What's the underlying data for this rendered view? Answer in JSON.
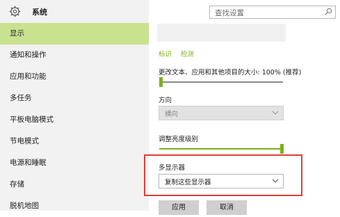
{
  "sidebar": {
    "title": "系统",
    "items": [
      {
        "label": "显示",
        "active": true
      },
      {
        "label": "通知和操作"
      },
      {
        "label": "应用和功能"
      },
      {
        "label": "多任务"
      },
      {
        "label": "平板电脑模式"
      },
      {
        "label": "节电模式"
      },
      {
        "label": "电源和睡眠"
      },
      {
        "label": "存储"
      },
      {
        "label": "脱机地图"
      }
    ]
  },
  "search": {
    "placeholder": "查找设置"
  },
  "main": {
    "links": {
      "identify": "标识",
      "detect": "检测"
    },
    "scale_label": "更改文本、应用和其他项目的大小: 100% (推荐)",
    "scale_value_percent": 100,
    "orientation": {
      "label": "方向",
      "value": "横向"
    },
    "brightness_label": "调整亮度级别",
    "brightness_level_fraction": 1.0,
    "multi_display": {
      "label": "多显示器",
      "value": "复制这些显示器"
    },
    "buttons": {
      "apply": "应用",
      "cancel": "取消"
    }
  },
  "colors": {
    "accent": "#79b21a",
    "active_bg": "#c9e28f",
    "highlight": "#e03c3c"
  }
}
